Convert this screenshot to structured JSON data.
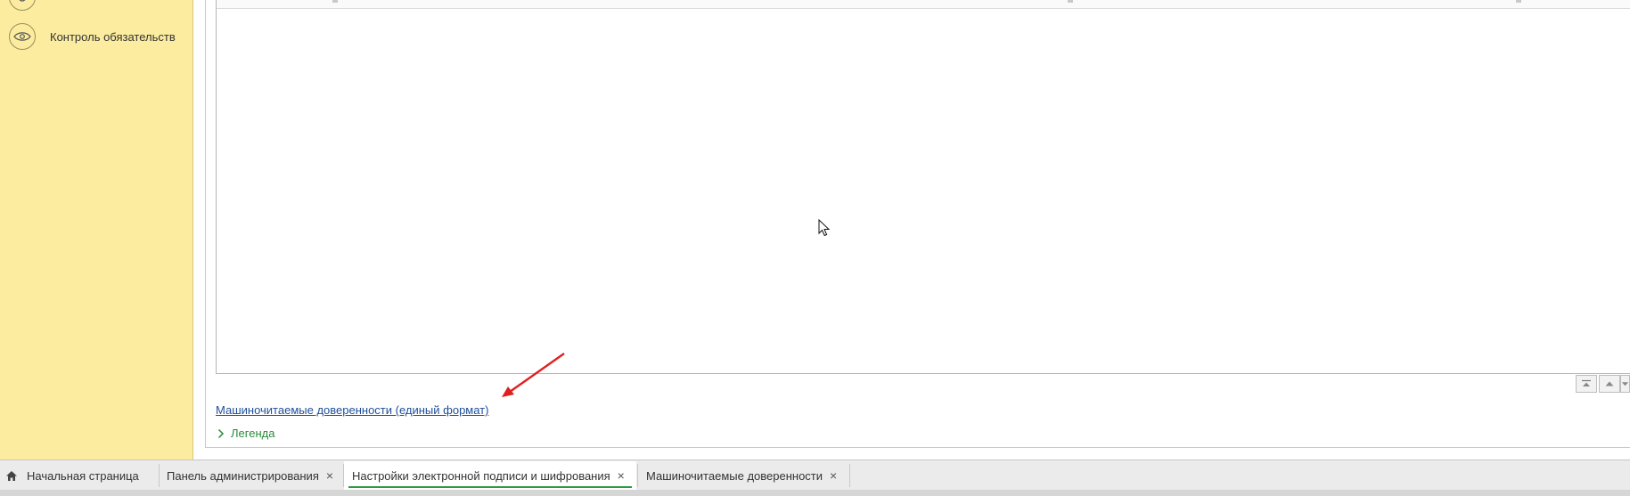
{
  "sidebar": {
    "items": [
      {
        "label": "",
        "icon": "circle-icon"
      },
      {
        "label": "Контроль обязательств",
        "icon": "eye-icon"
      }
    ]
  },
  "main": {
    "link_text": "Машиночитаемые доверенности (единый формат)",
    "legend_label": "Легенда",
    "scroll_buttons": [
      "scroll-to-top",
      "scroll-up",
      "scroll-down"
    ]
  },
  "tabs": [
    {
      "label": "Начальная страница",
      "icon": "home-icon",
      "closable": false,
      "active": false
    },
    {
      "label": "Панель администрирования",
      "closable": true,
      "active": false
    },
    {
      "label": "Настройки электронной подписи и шифрования",
      "closable": true,
      "active": true
    },
    {
      "label": "Машиночитаемые доверенности",
      "closable": true,
      "active": false
    }
  ],
  "tab_close_glyph": "×",
  "colors": {
    "sidebar_bg": "#fbec9f",
    "link": "#1f4e9b",
    "legend": "#2a8a3a",
    "active_tab_underline": "#2e9a3f",
    "annotation_arrow": "#e02020"
  }
}
